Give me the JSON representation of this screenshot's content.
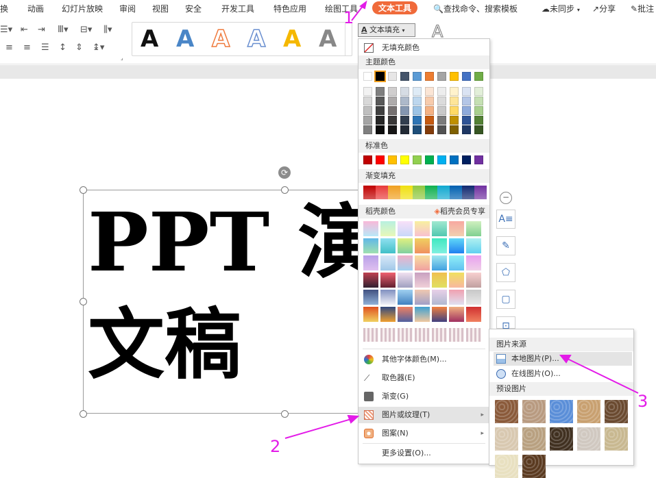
{
  "menu": {
    "items": [
      "换",
      "动画",
      "幻灯片放映",
      "审阅",
      "视图",
      "安全",
      "开发工具",
      "特色应用",
      "绘图工具"
    ],
    "active": "文本工具",
    "search": "查找命令、搜索模板",
    "sync": "未同步",
    "share": "分享",
    "note": "批注"
  },
  "ribbon": {
    "style_letters": [
      "A",
      "A",
      "A",
      "A",
      "A",
      "A"
    ],
    "style_colors": [
      "#111111",
      "#4a86c7",
      "#ef7a3d",
      "#6a8fd0",
      "#f5b800",
      "#888888"
    ],
    "text_fill_label": "文本填充"
  },
  "slide": {
    "line1": "PPT 演",
    "line2": "文稿"
  },
  "dropdown": {
    "no_fill": "无填充颜色",
    "theme_colors_title": "主题颜色",
    "theme_top": [
      "#ffffff",
      "#000000",
      "#e7e6e6",
      "#44546a",
      "#5b9bd5",
      "#ed7d31",
      "#a5a5a5",
      "#ffc000",
      "#4472c4",
      "#70ad47"
    ],
    "theme_shades": [
      [
        "#f2f2f2",
        "#7f7f7f",
        "#d0cece",
        "#d6dce4",
        "#deebf6",
        "#fbe5d5",
        "#ededed",
        "#fff2cc",
        "#dae3f3",
        "#e2efd9"
      ],
      [
        "#d8d8d8",
        "#595959",
        "#aeabab",
        "#adb9ca",
        "#bdd7ee",
        "#f7cbac",
        "#dbdbdb",
        "#fee599",
        "#b4c6e7",
        "#c5e0b3"
      ],
      [
        "#bfbfbf",
        "#3f3f3f",
        "#757070",
        "#8496b0",
        "#9cc3e5",
        "#f4b183",
        "#c9c9c9",
        "#ffd965",
        "#8eaadb",
        "#a8d08d"
      ],
      [
        "#a5a5a5",
        "#262626",
        "#3a3838",
        "#323f4f",
        "#2e75b5",
        "#c55a11",
        "#7b7b7b",
        "#bf9000",
        "#2f5496",
        "#538135"
      ],
      [
        "#7f7f7f",
        "#0c0c0c",
        "#171616",
        "#222a35",
        "#1e4e79",
        "#833c0b",
        "#525252",
        "#7f6000",
        "#1f3864",
        "#375623"
      ]
    ],
    "standard_title": "标准色",
    "standard_colors": [
      "#c00000",
      "#ff0000",
      "#ffc000",
      "#ffff00",
      "#92d050",
      "#00b050",
      "#00b0f0",
      "#0070c0",
      "#002060",
      "#7030a0"
    ],
    "gradient_title": "渐变填充",
    "gradient_colors": [
      "#c00000",
      "#e83a3a",
      "#f0a020",
      "#f0e010",
      "#90c840",
      "#10b050",
      "#10a8d0",
      "#0060b0",
      "#102870",
      "#7030a0"
    ],
    "wps_colors_title": "稻壳颜色",
    "wps_member": "稻壳会员专享",
    "more_font_colors": "其他字体颜色(M)...",
    "eyedropper": "取色器(E)",
    "gradient": "渐变(G)",
    "picture_texture": "图片或纹理(T)",
    "pattern": "图案(N)",
    "more_settings": "更多设置(O)..."
  },
  "submenu": {
    "source_title": "图片来源",
    "local_picture": "本地图片(P)...",
    "online_picture": "在线图片(O)...",
    "preset_title": "预设图片",
    "texture_colors": [
      "#8a5a3a",
      "#b89a80",
      "#5a8ed8",
      "#c8a070",
      "#6a4a30",
      "#d8c8b0",
      "#b8a080",
      "#403020",
      "#d0c8c0",
      "#c8b890",
      "#e8e0c0",
      "#5a3a20"
    ]
  },
  "annotations": {
    "n1": "1",
    "n2": "2",
    "n3": "3"
  }
}
